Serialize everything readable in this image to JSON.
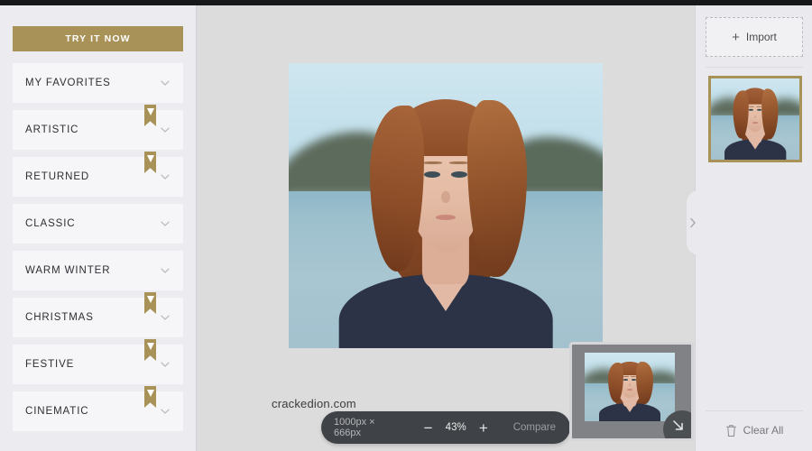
{
  "sidebar": {
    "cta": {
      "label": "TRY IT NOW"
    },
    "categories": [
      {
        "label": "MY FAVORITES",
        "bookmarked": false
      },
      {
        "label": "ARTISTIC",
        "bookmarked": true
      },
      {
        "label": "RETURNED",
        "bookmarked": true
      },
      {
        "label": "CLASSIC",
        "bookmarked": false
      },
      {
        "label": "WARM WINTER",
        "bookmarked": false
      },
      {
        "label": "CHRISTMAS",
        "bookmarked": true
      },
      {
        "label": "FESTIVE",
        "bookmarked": true
      },
      {
        "label": "CINEMATIC",
        "bookmarked": true
      }
    ]
  },
  "canvas": {
    "watermark": "crackedion.com",
    "zoombar": {
      "dimensions": "1000px × 666px",
      "zoom_out": "−",
      "zoom_level": "43%",
      "zoom_in": "+",
      "compare": "Compare"
    }
  },
  "right_panel": {
    "import": {
      "plus": "+",
      "label": "Import"
    },
    "clear_all": {
      "label": "Clear All"
    }
  },
  "colors": {
    "accent_gold": "#a89257",
    "sidebar_bg": "#ebebf0",
    "canvas_bg": "#dcdcdc",
    "panel_bg": "#eaeaee",
    "zoombar_bg": "#3f4246"
  }
}
